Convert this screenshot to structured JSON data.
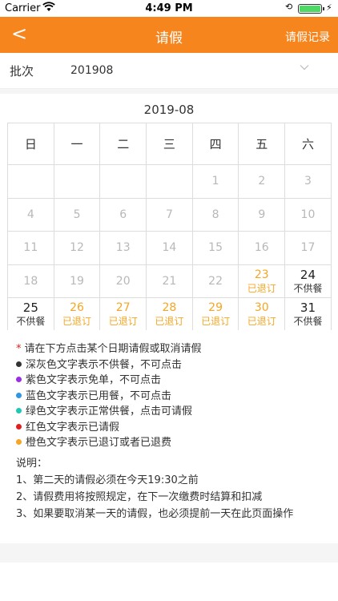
{
  "status_bar": {
    "carrier": "Carrier",
    "time": "4:49 PM",
    "battery_level": 1.0
  },
  "nav": {
    "back_glyph": "<",
    "title": "请假",
    "record_label": "请假记录"
  },
  "batch": {
    "label": "批次",
    "value": "201908"
  },
  "calendar": {
    "month": "2019-08",
    "weekdays": [
      "日",
      "一",
      "二",
      "三",
      "四",
      "五",
      "六"
    ],
    "weeks": [
      [
        {
          "n": "",
          "s": ""
        },
        {
          "n": "",
          "s": ""
        },
        {
          "n": "",
          "s": ""
        },
        {
          "n": "",
          "s": ""
        },
        {
          "n": "1",
          "s": ""
        },
        {
          "n": "2",
          "s": ""
        },
        {
          "n": "3",
          "s": ""
        }
      ],
      [
        {
          "n": "4",
          "s": ""
        },
        {
          "n": "5",
          "s": ""
        },
        {
          "n": "6",
          "s": ""
        },
        {
          "n": "7",
          "s": ""
        },
        {
          "n": "8",
          "s": ""
        },
        {
          "n": "9",
          "s": ""
        },
        {
          "n": "10",
          "s": ""
        }
      ],
      [
        {
          "n": "11",
          "s": ""
        },
        {
          "n": "12",
          "s": ""
        },
        {
          "n": "13",
          "s": ""
        },
        {
          "n": "14",
          "s": ""
        },
        {
          "n": "15",
          "s": ""
        },
        {
          "n": "16",
          "s": ""
        },
        {
          "n": "17",
          "s": ""
        }
      ],
      [
        {
          "n": "18",
          "s": ""
        },
        {
          "n": "19",
          "s": ""
        },
        {
          "n": "20",
          "s": ""
        },
        {
          "n": "21",
          "s": ""
        },
        {
          "n": "22",
          "s": ""
        },
        {
          "n": "23",
          "s": "已退订"
        },
        {
          "n": "24",
          "s": "不供餐"
        }
      ],
      [
        {
          "n": "25",
          "s": "不供餐"
        },
        {
          "n": "26",
          "s": "已退订"
        },
        {
          "n": "27",
          "s": "已退订"
        },
        {
          "n": "28",
          "s": "已退订"
        },
        {
          "n": "29",
          "s": "已退订"
        },
        {
          "n": "30",
          "s": "已退订"
        },
        {
          "n": "31",
          "s": "不供餐"
        }
      ]
    ],
    "cell_styles": [
      [
        "c-gray",
        "c-gray",
        "c-gray",
        "c-gray",
        "c-gray",
        "c-gray",
        "c-gray"
      ],
      [
        "c-gray",
        "c-gray",
        "c-gray",
        "c-gray",
        "c-gray",
        "c-gray",
        "c-gray"
      ],
      [
        "c-gray",
        "c-gray",
        "c-gray",
        "c-gray",
        "c-gray",
        "c-gray",
        "c-gray"
      ],
      [
        "c-gray",
        "c-gray",
        "c-gray",
        "c-gray",
        "c-gray",
        "c-orange",
        "c-dark"
      ],
      [
        "c-dark",
        "c-orange",
        "c-orange",
        "c-orange",
        "c-orange",
        "c-orange",
        "c-dark"
      ]
    ]
  },
  "legend": {
    "intro": "请在下方点击某个日期请假或取消请假",
    "items": [
      {
        "color": "#333333",
        "text": "深灰色文字表示不供餐，不可点击"
      },
      {
        "color": "#9b2ee3",
        "text": "紫色文字表示免单，不可点击"
      },
      {
        "color": "#2e96e3",
        "text": "蓝色文字表示已用餐，不可点击"
      },
      {
        "color": "#1ec8b4",
        "text": "绿色文字表示正常供餐，点击可请假"
      },
      {
        "color": "#e02020",
        "text": "红色文字表示已请假"
      },
      {
        "color": "#f5a623",
        "text": "橙色文字表示已退订或者已退费"
      }
    ]
  },
  "notes": {
    "title": "说明：",
    "lines": [
      "1、第二天的请假必须在今天19:30之前",
      "2、请假费用将按照规定，在下一次缴费时结算和扣减",
      "3、如果要取消某一天的请假，也必须提前一天在此页面操作"
    ]
  },
  "colors": {
    "accent": "#f7851d",
    "status_orange": "#f5a623"
  }
}
